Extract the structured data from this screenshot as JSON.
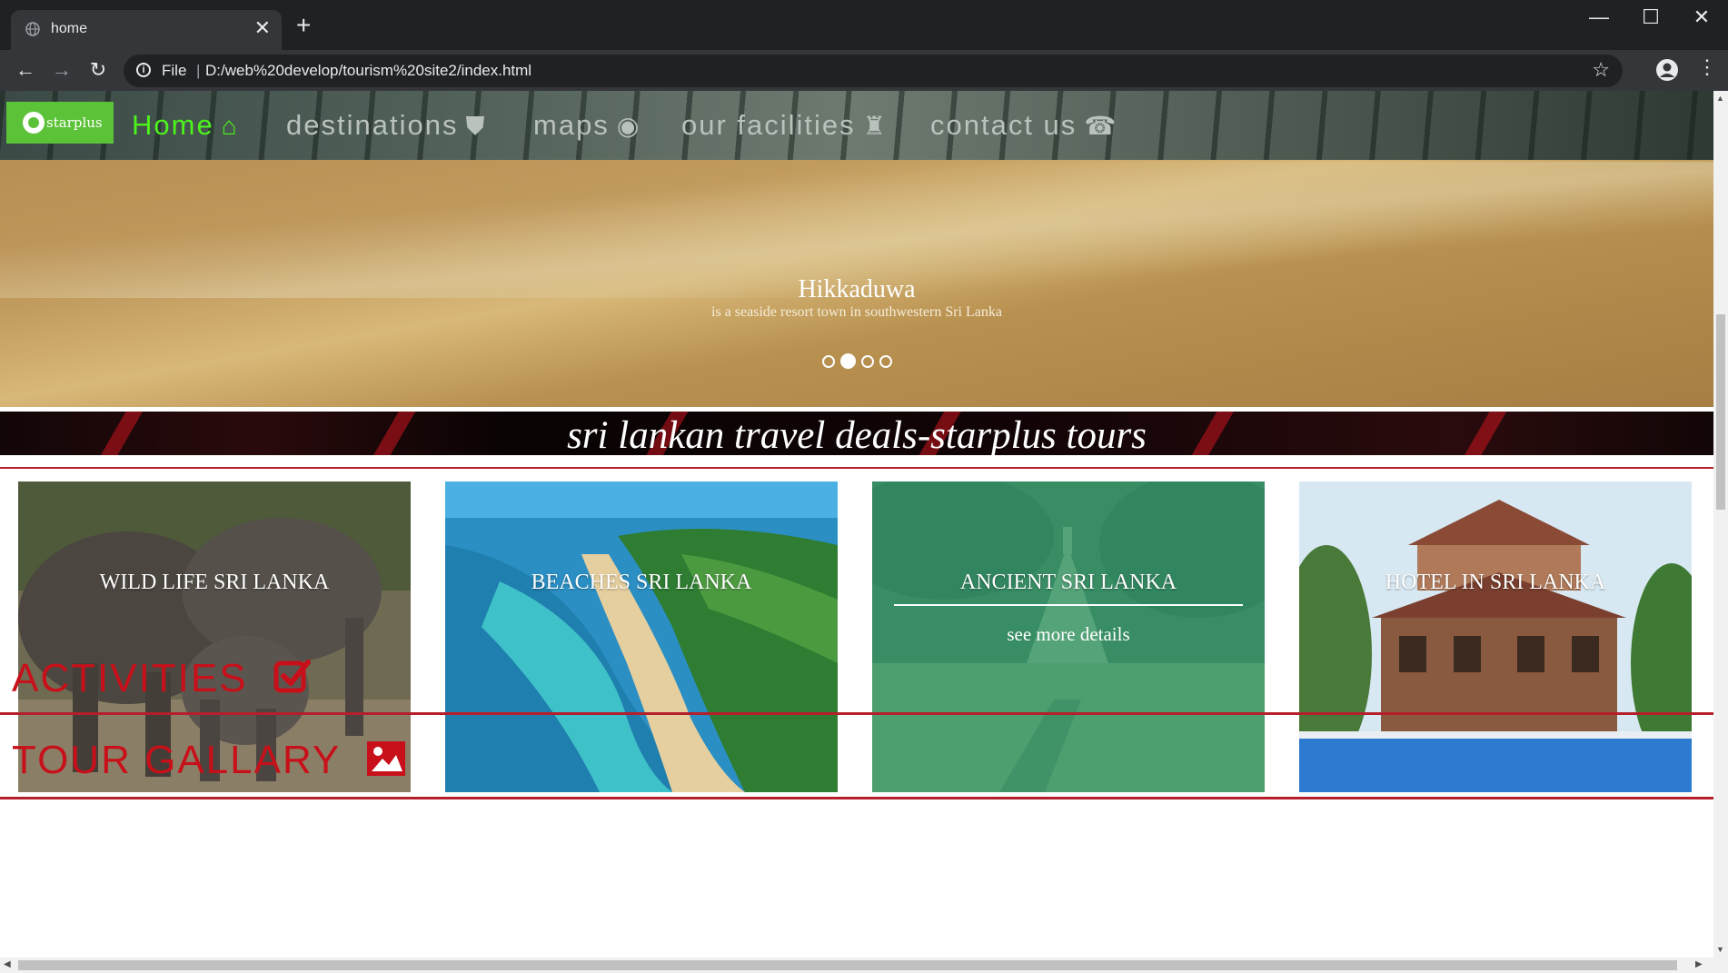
{
  "browser": {
    "tab_title": "home",
    "tab_close": "✕",
    "new_tab": "+",
    "window_controls": {
      "minimize": "—",
      "maximize": "☐",
      "close": "✕"
    },
    "nav": {
      "back": "←",
      "forward": "→",
      "reload": "↻"
    },
    "address": {
      "info_glyph": "i",
      "scheme": "File",
      "separator": "|",
      "url": "D:/web%20develop/tourism%20site2/index.html"
    },
    "star": "☆",
    "menu": "⋮"
  },
  "nav": {
    "logo_text": "starplus",
    "items": [
      {
        "label": "Home",
        "icon": "home-icon",
        "glyph": "⌂",
        "active": true
      },
      {
        "label": "destinations",
        "icon": "road-icon",
        "glyph": "⛊",
        "active": false
      },
      {
        "label": "maps",
        "icon": "eye-icon",
        "glyph": "◉",
        "active": false
      },
      {
        "label": "our facilities",
        "icon": "bell-icon",
        "glyph": "♜",
        "active": false
      },
      {
        "label": "contact us",
        "icon": "phone-icon",
        "glyph": "☎",
        "active": false
      }
    ]
  },
  "hero": {
    "title": "Hikkaduwa",
    "subtitle": "is a seaside resort town in southwestern Sri Lanka",
    "slide_count": 4,
    "active_slide": 2
  },
  "banner": {
    "text": "sri lankan travel deals-starplus tours"
  },
  "cards": [
    {
      "title": "WILD LIFE SRI LANKA"
    },
    {
      "title": "BEACHES SRI LANKA"
    },
    {
      "title": "ANCIENT SRI LANKA",
      "link": "see more details"
    },
    {
      "title": "HOTEL IN SRI LANKA"
    }
  ],
  "sections": {
    "activities": {
      "label": "ACTIVITIES",
      "icon": "check-square-icon"
    },
    "gallery": {
      "label": "TOUR GALLARY",
      "icon": "picture-icon"
    }
  },
  "colors": {
    "nav_active": "#4cf31c",
    "accent_red": "#c8101a",
    "logo_green": "#5cc238"
  }
}
